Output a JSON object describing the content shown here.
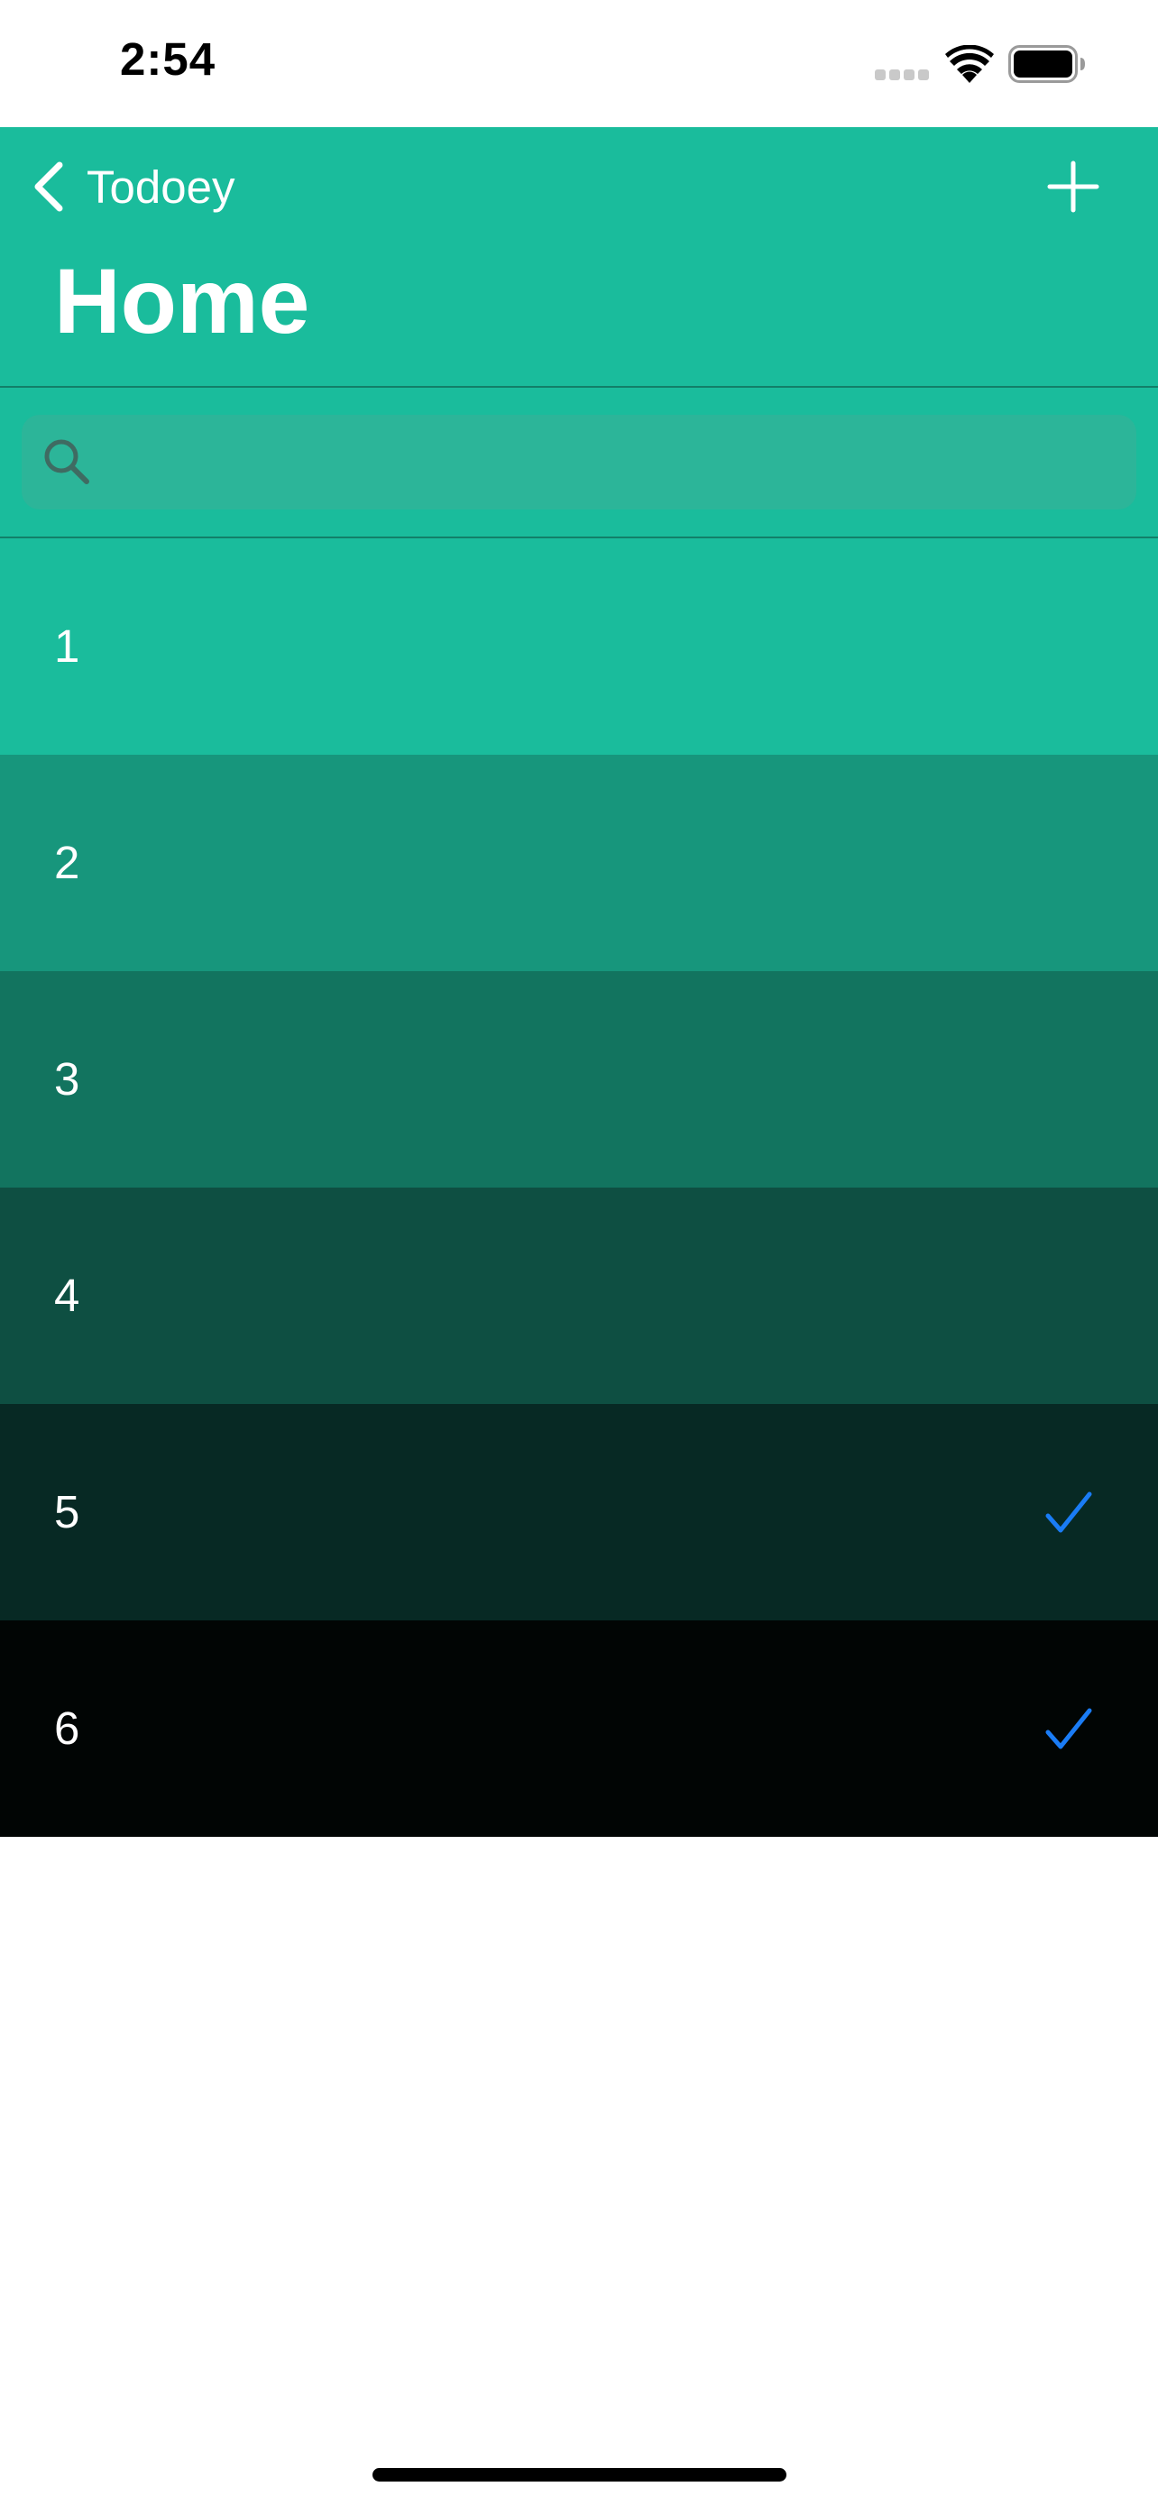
{
  "status_bar": {
    "time": "2:54",
    "icons": [
      "signal-icon",
      "wifi-icon",
      "battery-icon"
    ]
  },
  "nav": {
    "back_label": "Todoey",
    "title": "Home",
    "back_icon": "chevron-left-icon",
    "add_icon": "plus-icon",
    "background_color": "#1abc9c"
  },
  "search": {
    "placeholder": "",
    "value": "",
    "icon": "search-icon"
  },
  "items": [
    {
      "title": "1",
      "done": false,
      "color": "#1abc9c"
    },
    {
      "title": "2",
      "done": false,
      "color": "#17967c"
    },
    {
      "title": "3",
      "done": false,
      "color": "#12745f"
    },
    {
      "title": "4",
      "done": false,
      "color": "#0e4f42"
    },
    {
      "title": "5",
      "done": true,
      "color": "#072924"
    },
    {
      "title": "6",
      "done": true,
      "color": "#010504"
    }
  ],
  "checkmark_color": "#1a7cf5"
}
